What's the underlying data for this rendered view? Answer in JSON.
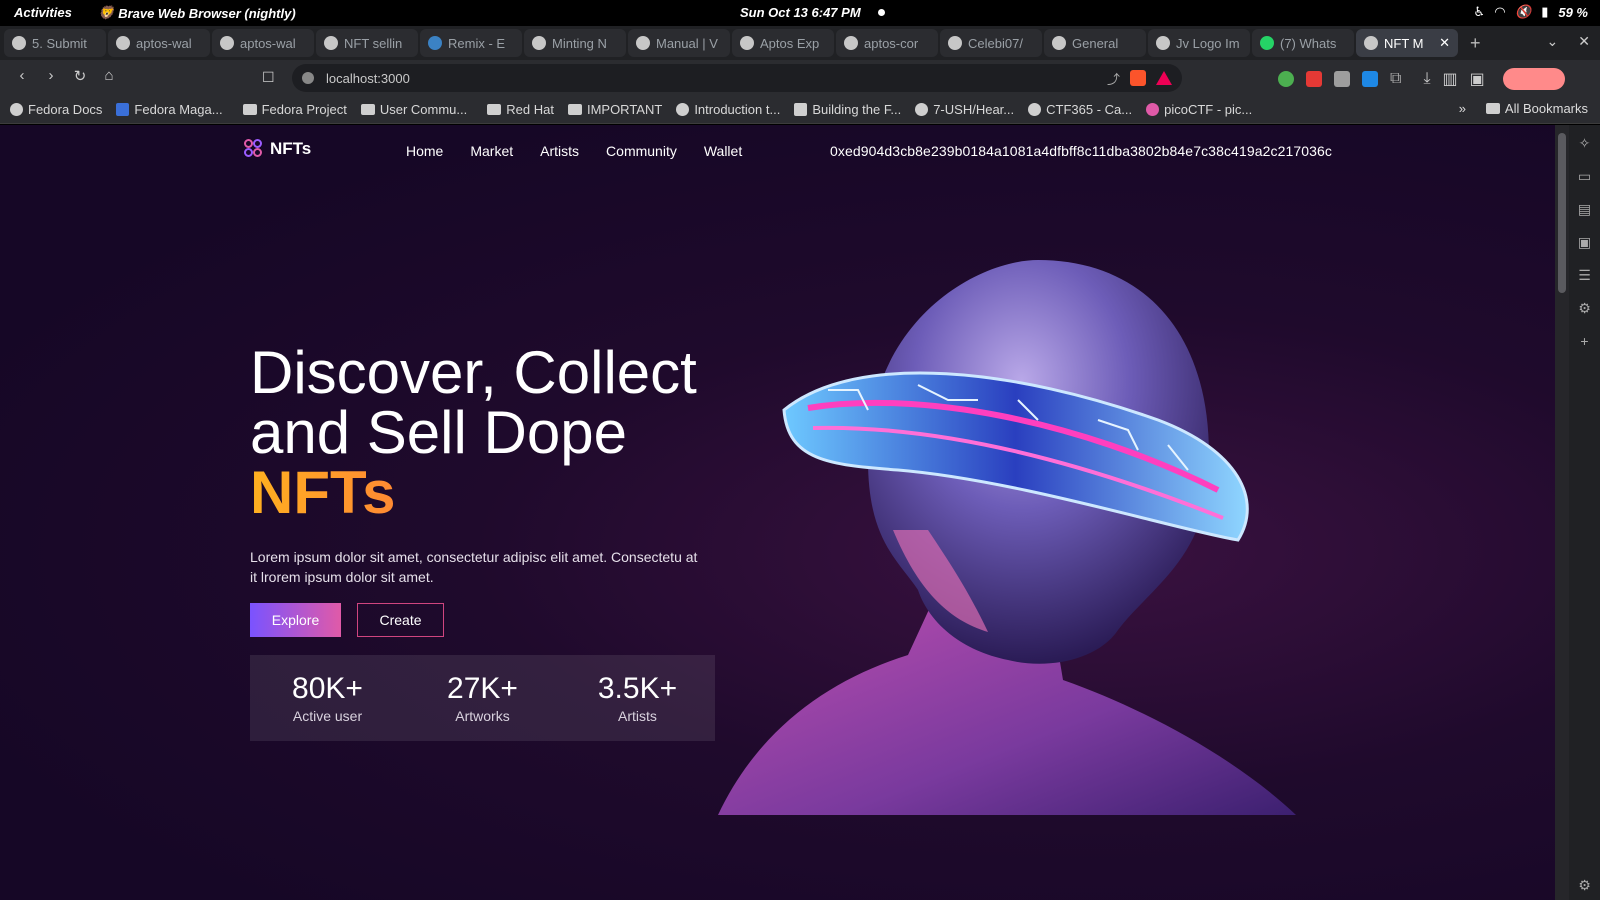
{
  "system": {
    "activities": "Activities",
    "app_name": "Brave Web Browser (nightly)",
    "clock": "Sun Oct 13   6:47 PM",
    "battery": "59 %"
  },
  "tabs": [
    {
      "label": "5. Submit"
    },
    {
      "label": "aptos-wal"
    },
    {
      "label": "aptos-wal"
    },
    {
      "label": "NFT sellin"
    },
    {
      "label": "Remix - E"
    },
    {
      "label": "Minting N"
    },
    {
      "label": "Manual | V"
    },
    {
      "label": "Aptos Exp"
    },
    {
      "label": "aptos-cor"
    },
    {
      "label": "Celebi07/"
    },
    {
      "label": "General"
    },
    {
      "label": "Jv Logo Im"
    },
    {
      "label": "(7) Whats"
    },
    {
      "label": "NFT M",
      "active": true
    }
  ],
  "address_bar": {
    "url": "localhost:3000"
  },
  "bookmarks": [
    {
      "label": "Fedora Docs",
      "type": "site"
    },
    {
      "label": "Fedora Maga...",
      "type": "site"
    },
    {
      "label": "Fedora Project",
      "type": "folder"
    },
    {
      "label": "User Commu...",
      "type": "folder"
    },
    {
      "label": "Red Hat",
      "type": "folder"
    },
    {
      "label": "IMPORTANT",
      "type": "folder"
    },
    {
      "label": "Introduction t...",
      "type": "site"
    },
    {
      "label": "Building the F...",
      "type": "site"
    },
    {
      "label": "7-USH/Hear...",
      "type": "site"
    },
    {
      "label": "CTF365 - Ca...",
      "type": "site"
    },
    {
      "label": "picoCTF - pic...",
      "type": "site"
    }
  ],
  "bookmarks_more": "»",
  "all_bookmarks": "All Bookmarks",
  "site": {
    "logo": "NFTs",
    "menu": [
      "Home",
      "Market",
      "Artists",
      "Community",
      "Wallet"
    ],
    "wallet_address": "0xed904d3cb8e239b0184a1081a4dfbff8c11dba3802b84e7c38c419a2c217036c",
    "hero": {
      "line1": "Discover, Collect",
      "line2": "and Sell Dope",
      "accent": "NFTs",
      "description": "Lorem ipsum dolor sit amet, consectetur adipisc elit amet. Consectetu at it lrorem ipsum dolor sit amet.",
      "explore": "Explore",
      "create": "Create"
    },
    "stats": [
      {
        "value": "80K+",
        "label": "Active user"
      },
      {
        "value": "27K+",
        "label": "Artworks"
      },
      {
        "value": "3.5K+",
        "label": "Artists"
      }
    ]
  },
  "colors": {
    "accent_start": "#ffb020",
    "accent_end": "#ff3a5a",
    "button_start": "#7a53ff",
    "button_end": "#e05aa8",
    "page_bg": "#1f0a2c"
  }
}
